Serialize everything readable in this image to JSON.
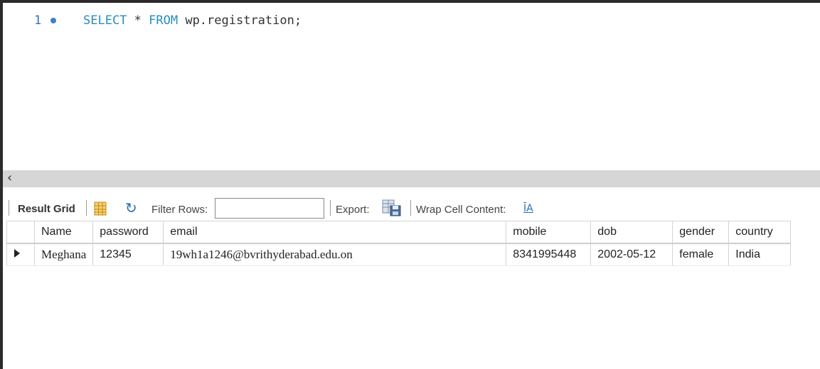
{
  "editor": {
    "line_number": "1",
    "sql": {
      "kw_select": "SELECT",
      "star": " * ",
      "kw_from": "FROM",
      "rest": " wp.registration;"
    }
  },
  "result_toolbar": {
    "result_grid_label": "Result Grid",
    "filter_rows_label": "Filter Rows:",
    "filter_value": "",
    "export_label": "Export:",
    "wrap_cell_label": "Wrap Cell Content:",
    "wrap_icon_glyph": "ĪA"
  },
  "table": {
    "columns": [
      "Name",
      "password",
      "email",
      "mobile",
      "dob",
      "gender",
      "country"
    ],
    "rows": [
      [
        "Meghana",
        "12345",
        "19wh1a1246@bvrithyderabad.edu.on",
        "8341995448",
        "2002-05-12",
        "female",
        "India"
      ]
    ]
  },
  "colors": {
    "keyword": "#2a8cbf",
    "line_number": "#2f74b8",
    "scrollbar": "#d6d6d6"
  }
}
